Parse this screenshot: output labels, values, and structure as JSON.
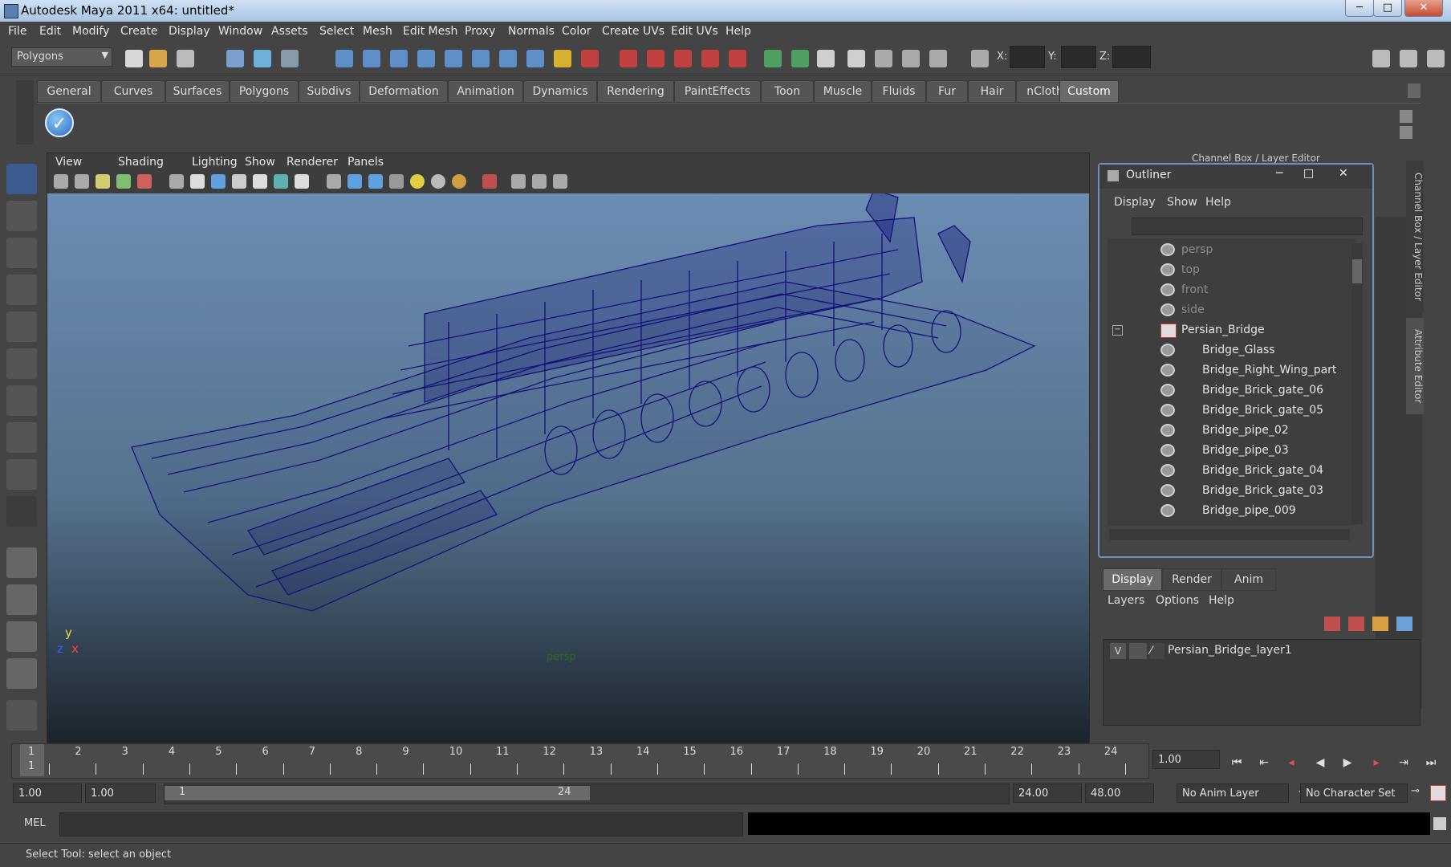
{
  "window": {
    "title": "Autodesk Maya 2011 x64: untitled*",
    "min": "─",
    "max": "□",
    "close": "✕"
  },
  "menubar": [
    "File",
    "Edit",
    "Modify",
    "Create",
    "Display",
    "Window",
    "Assets",
    "Select",
    "Mesh",
    "Edit Mesh",
    "Proxy",
    "Normals",
    "Color",
    "Create UVs",
    "Edit UVs",
    "Help"
  ],
  "status": {
    "menuset": "Polygons",
    "x_label": "X:",
    "y_label": "Y:",
    "z_label": "Z:"
  },
  "shelf": {
    "tabs": [
      "General",
      "Curves",
      "Surfaces",
      "Polygons",
      "Subdivs",
      "Deformation",
      "Animation",
      "Dynamics",
      "Rendering",
      "PaintEffects",
      "Toon",
      "Muscle",
      "Fluids",
      "Fur",
      "Hair",
      "nCloth",
      "Custom"
    ],
    "active": "Custom"
  },
  "viewport": {
    "menu": [
      "View",
      "Shading",
      "Lighting",
      "Show",
      "Renderer",
      "Panels"
    ],
    "camera_label": "persp",
    "axis_y": "y",
    "axis_z": "z",
    "axis_x": "x"
  },
  "channel_box": {
    "title": "Channel Box / Layer Editor",
    "side_tab1": "Channel Box / Layer Editor",
    "side_tab2": "Attribute Editor"
  },
  "outliner": {
    "title": "Outliner",
    "menu": [
      "Display",
      "Show",
      "Help"
    ],
    "items": [
      {
        "label": "persp",
        "dim": true
      },
      {
        "label": "top",
        "dim": true
      },
      {
        "label": "front",
        "dim": true
      },
      {
        "label": "side",
        "dim": true
      },
      {
        "label": "Persian_Bridge",
        "dim": false
      },
      {
        "label": "Bridge_Glass",
        "dim": false
      },
      {
        "label": "Bridge_Right_Wing_part",
        "dim": false
      },
      {
        "label": "Bridge_Brick_gate_06",
        "dim": false
      },
      {
        "label": "Bridge_Brick_gate_05",
        "dim": false
      },
      {
        "label": "Bridge_pipe_02",
        "dim": false
      },
      {
        "label": "Bridge_pipe_03",
        "dim": false
      },
      {
        "label": "Bridge_Brick_gate_04",
        "dim": false
      },
      {
        "label": "Bridge_Brick_gate_03",
        "dim": false
      },
      {
        "label": "Bridge_pipe_009",
        "dim": false
      }
    ]
  },
  "layer_editor": {
    "tabs": [
      "Display",
      "Render",
      "Anim"
    ],
    "active": "Display",
    "menu": [
      "Layers",
      "Options",
      "Help"
    ],
    "layer": {
      "visible": "V",
      "name": "Persian_Bridge_layer1"
    }
  },
  "timeline": {
    "ticks": [
      "1",
      "2",
      "3",
      "4",
      "5",
      "6",
      "7",
      "8",
      "9",
      "10",
      "11",
      "12",
      "13",
      "14",
      "15",
      "16",
      "17",
      "18",
      "19",
      "20",
      "21",
      "22",
      "23",
      "24"
    ],
    "current_frame_marker": "1",
    "current_time": "1.00"
  },
  "range": {
    "start_time": "1.00",
    "playback_start": "1.00",
    "slider_start": "1",
    "slider_end": "24",
    "playback_end": "24.00",
    "end_time": "48.00",
    "anim_layer": "No Anim Layer",
    "character_set": "No Character Set"
  },
  "command": {
    "label": "MEL"
  },
  "help_line": "Select Tool: select an object"
}
